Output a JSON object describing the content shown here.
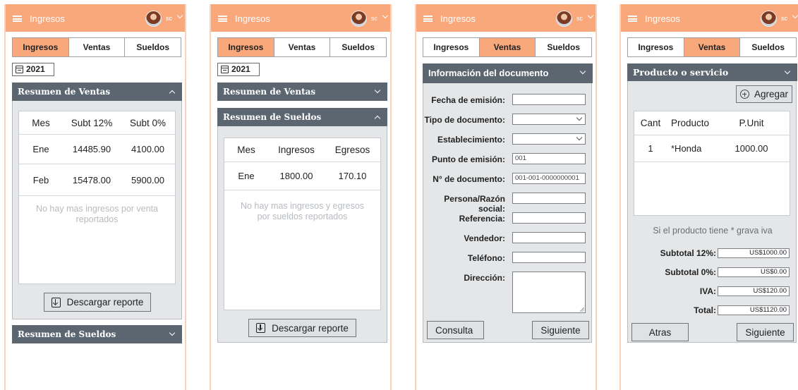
{
  "app": {
    "title": "Ingresos",
    "user_initials": "sc"
  },
  "tabs": [
    "Ingresos",
    "Ventas",
    "Sueldos"
  ],
  "year_filter": "2021",
  "screen1": {
    "ventas_header": "Resumen de Ventas",
    "table_headers": [
      "Mes",
      "Subt 12%",
      "Subt 0%"
    ],
    "rows": [
      [
        "Ene",
        "14485.90",
        "4100.00"
      ],
      [
        "Feb",
        "15478.00",
        "5900.00"
      ]
    ],
    "empty_message": "No hay mas ingresos por venta reportados",
    "download_label": "Descargar reporte",
    "sueldos_header": "Resumen de Sueldos"
  },
  "screen2": {
    "ventas_header": "Resumen de Ventas",
    "sueldos_header": "Resumen de Sueldos",
    "table_headers": [
      "Mes",
      "Ingresos",
      "Egresos"
    ],
    "rows": [
      [
        "Ene",
        "1800.00",
        "170.10"
      ]
    ],
    "empty_message": "No hay mas ingresos y egresos por sueldos reportados",
    "download_label": "Descargar reporte"
  },
  "screen3": {
    "section_header": "Información  del documento",
    "fields": [
      {
        "label": "Fecha de emisión:",
        "value": ""
      },
      {
        "label": "Tipo de documento:",
        "value": ""
      },
      {
        "label": "Establecimiento:",
        "value": ""
      },
      {
        "label": "Punto de emisión:",
        "value": "001"
      },
      {
        "label": "N° de documento:",
        "value": "001-001-0000000001"
      },
      {
        "label": "Persona/Razón social:",
        "value": ""
      },
      {
        "label": "Referencia:",
        "value": ""
      },
      {
        "label": "Vendedor:",
        "value": ""
      },
      {
        "label": "Teléfono:",
        "value": ""
      },
      {
        "label": "Dirección:",
        "value": ""
      }
    ],
    "consult_label": "Consulta",
    "next_label": "Siguiente"
  },
  "screen4": {
    "section_header": "Producto o servicio",
    "add_label": "Agregar",
    "table_headers": [
      "Cant",
      "Producto",
      "P.Unit"
    ],
    "rows": [
      [
        "1",
        "*Honda",
        "1000.00"
      ]
    ],
    "tax_note": "Si el producto tiene * grava iva",
    "totals": [
      {
        "label": "Subtotal 12%:",
        "value": "US$1000.00"
      },
      {
        "label": "Subtotal 0%:",
        "value": "US$0.00"
      },
      {
        "label": "IVA:",
        "value": "US$120.00"
      },
      {
        "label": "Total:",
        "value": "US$1120.00"
      }
    ],
    "back_label": "Atras",
    "next_label": "Siguiente"
  }
}
